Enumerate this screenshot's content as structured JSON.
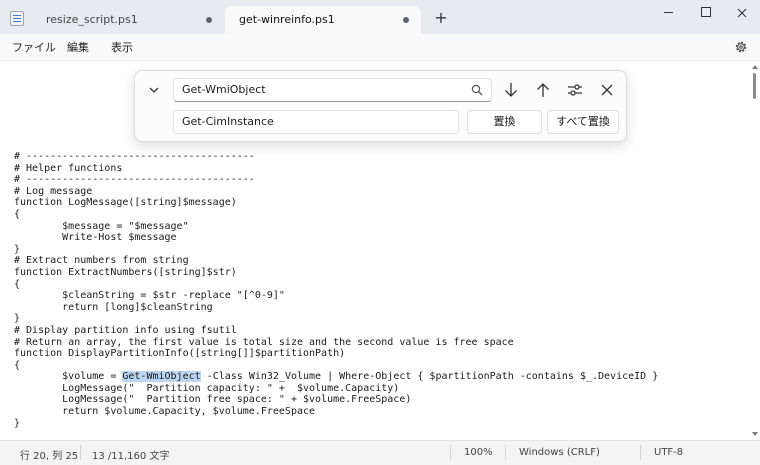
{
  "tabs": [
    {
      "label": "resize_script.ps1",
      "active": false,
      "unsaved": true
    },
    {
      "label": "get-winreinfo.ps1",
      "active": true,
      "unsaved": true
    }
  ],
  "new_tab": "+",
  "menu": {
    "file": "ファイル",
    "edit": "編集",
    "view": "表示"
  },
  "find": {
    "search_value": "Get-WmiObject",
    "replace_value": "Get-CimInstance",
    "replace_label": "置換",
    "replace_all_label": "すべて置換"
  },
  "editor": {
    "lines": [
      "# --------------------------------------",
      "# Helper functions",
      "# --------------------------------------",
      "# Log message",
      "function LogMessage([string]$message)",
      "{",
      "        $message = \"$message\"",
      "        Write-Host $message",
      "}",
      "# Extract numbers from string",
      "function ExtractNumbers([string]$str)",
      "{",
      "        $cleanString = $str -replace \"[^0-9]\"",
      "        return [long]$cleanString",
      "}",
      "# Display partition info using fsutil",
      "# Return an array, the first value is total size and the second value is free space",
      "function DisplayPartitionInfo([string[]]$partitionPath)",
      "{",
      "        $volume = Get-WmiObject -Class Win32_Volume | Where-Object { $partitionPath -contains $_.DeviceID }",
      "        LogMessage(\"  Partition capacity: \" +  $volume.Capacity)",
      "        LogMessage(\"  Partition free space: \" + $volume.FreeSpace)",
      "        return $volume.Capacity, $volume.FreeSpace",
      "}"
    ],
    "highlight_line": 19,
    "highlight_text": "Get-WmiObject"
  },
  "status": {
    "position": "行 20, 列 25",
    "char_count": "13 /11,160 文字",
    "zoom": "100%",
    "line_ending": "Windows (CRLF)",
    "encoding": "UTF-8"
  },
  "colors": {
    "accent": "#0067c0",
    "selection": "#bcd5f0",
    "titlebar": "#e7ebf0"
  }
}
